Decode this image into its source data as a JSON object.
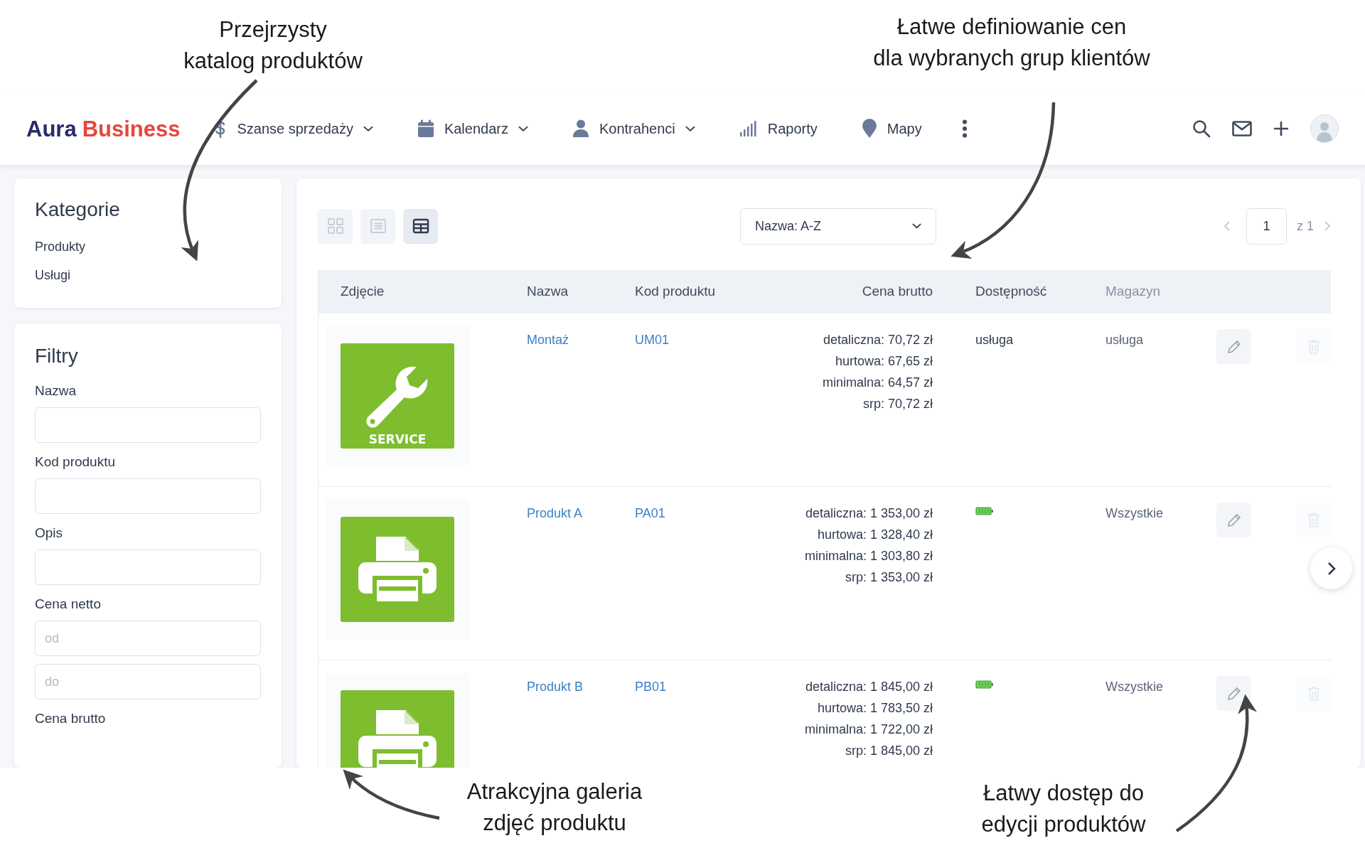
{
  "annotations": [
    {
      "text": "Przejrzysty\nkatalog produktów"
    },
    {
      "text": "Łatwe definiowanie cen\ndla wybranych grup klientów"
    },
    {
      "text": "Atrakcyjna galeria\nzdjęć produktu"
    },
    {
      "text": "Łatwy dostęp do\nedycji produktów"
    }
  ],
  "nav": {
    "logo": [
      "Aura",
      "Business"
    ],
    "items": [
      {
        "label": "Szanse sprzedaży",
        "kind": "dollar",
        "dropdown": true
      },
      {
        "label": "Kalendarz",
        "kind": "calendar",
        "dropdown": true
      },
      {
        "label": "Kontrahenci",
        "kind": "user",
        "dropdown": true
      },
      {
        "label": "Raporty",
        "kind": "bars",
        "dropdown": false
      },
      {
        "label": "Mapy",
        "kind": "pin",
        "dropdown": false
      }
    ]
  },
  "categories": {
    "title": "Kategorie",
    "items": [
      "Produkty",
      "Usługi"
    ]
  },
  "filters": {
    "title": "Filtry",
    "fields": [
      {
        "label": "Nazwa",
        "kind": "input"
      },
      {
        "label": "Kod produktu",
        "kind": "input"
      },
      {
        "label": "Opis",
        "kind": "input"
      },
      {
        "label": "Cena netto",
        "kind": "range",
        "placeholders": [
          "od",
          "do"
        ]
      },
      {
        "label": "Cena brutto",
        "kind": "label"
      }
    ]
  },
  "toolbar": {
    "views": [
      {
        "kind": "grid",
        "selected": false
      },
      {
        "kind": "list",
        "selected": false
      },
      {
        "kind": "table",
        "selected": true
      }
    ],
    "sort": "Nazwa: A-Z",
    "page": "1",
    "page_total": "z 1"
  },
  "table": {
    "columns": [
      "Zdjęcie",
      "Nazwa",
      "Kod produktu",
      "Cena brutto",
      "Dostępność",
      "Magazyn"
    ],
    "rows": [
      {
        "image": {
          "kind": "service",
          "caption": "SERVICE"
        },
        "name": "Montaż",
        "code": "UM01",
        "prices": [
          "detaliczna: 70,72 zł",
          "hurtowa: 67,65 zł",
          "minimalna: 64,57 zł",
          "srp: 70,72 zł"
        ],
        "availability": {
          "kind": "text",
          "text": "usługa"
        },
        "warehouse": "usługa"
      },
      {
        "image": {
          "kind": "printer"
        },
        "name": "Produkt A",
        "code": "PA01",
        "prices": [
          "detaliczna: 1 353,00 zł",
          "hurtowa: 1 328,40 zł",
          "minimalna: 1 303,80 zł",
          "srp: 1 353,00 zł"
        ],
        "availability": {
          "kind": "battery"
        },
        "warehouse": "Wszystkie"
      },
      {
        "image": {
          "kind": "printer"
        },
        "name": "Produkt B",
        "code": "PB01",
        "prices": [
          "detaliczna: 1 845,00 zł",
          "hurtowa: 1 783,50 zł",
          "minimalna: 1 722,00 zł",
          "srp: 1 845,00 zł"
        ],
        "availability": {
          "kind": "battery"
        },
        "warehouse": "Wszystkie"
      }
    ]
  }
}
